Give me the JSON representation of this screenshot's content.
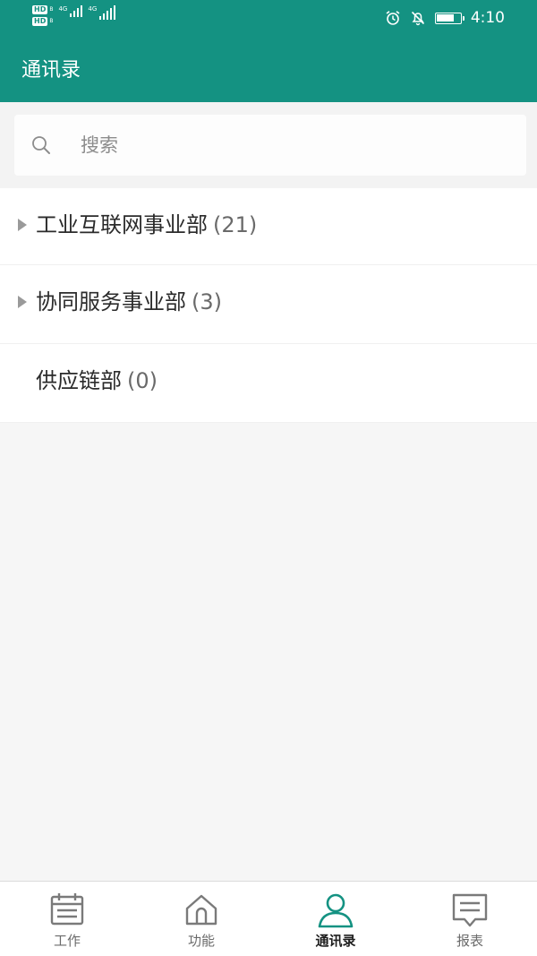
{
  "status_bar": {
    "time": "4:10",
    "sim1": {
      "badge": "HD",
      "sub": "B",
      "network": "4G"
    },
    "sim2": {
      "badge": "HD",
      "sub": "B",
      "network": "4G"
    },
    "battery_level": 0.8,
    "icons": [
      "alarm-icon",
      "notifications-off-icon",
      "battery-icon"
    ]
  },
  "header": {
    "title": "通讯录"
  },
  "search": {
    "placeholder": "搜索",
    "icon": "search-icon"
  },
  "departments": [
    {
      "name": "工业互联网事业部",
      "count": "(21)",
      "expandable": true
    },
    {
      "name": "协同服务事业部",
      "count": "(3)",
      "expandable": true
    },
    {
      "name": "供应链部",
      "count": "(0)",
      "expandable": false
    }
  ],
  "bottom_nav": {
    "items": [
      {
        "label": "工作",
        "icon": "calendar-icon",
        "active": false
      },
      {
        "label": "功能",
        "icon": "home-icon",
        "active": false
      },
      {
        "label": "通讯录",
        "icon": "contacts-icon",
        "active": true
      },
      {
        "label": "报表",
        "icon": "report-icon",
        "active": false
      }
    ]
  },
  "colors": {
    "primary": "#149282",
    "background": "#f6f6f6",
    "text": "#2b2b2b",
    "active_icon": "#149282",
    "inactive_icon": "#7a7a7a"
  }
}
